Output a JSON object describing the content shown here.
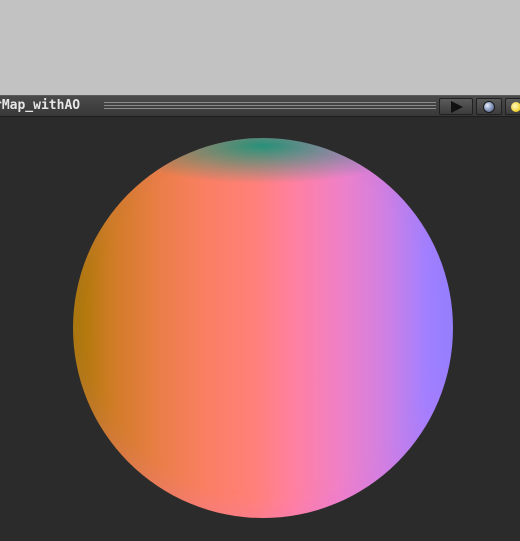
{
  "window": {
    "title": "rMap_withAO"
  },
  "toolbar": {
    "buttons": [
      {
        "icon": "play-icon"
      },
      {
        "icon": "sphere-icon"
      },
      {
        "icon": "light-icon"
      }
    ]
  },
  "colors": {
    "top_area": "#c2c2c2",
    "header_bar": "#3f3f3f",
    "viewport_bg": "#2b2b2b",
    "sphere_left": "#a67800",
    "sphere_center": "#ff807a",
    "sphere_right": "#8f80ff",
    "sphere_top": "#009678"
  }
}
